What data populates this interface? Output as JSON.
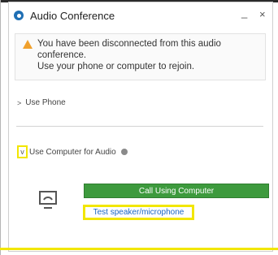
{
  "window": {
    "title": "Audio Conference",
    "minimize_label": "_",
    "close_label": "×",
    "app_icon": "audio-conference-icon"
  },
  "alert": {
    "icon": "warning-icon",
    "line1": "You have been disconnected from this audio conference.",
    "line2": "Use your phone or computer to rejoin."
  },
  "options": {
    "use_phone": {
      "chevron": ">",
      "label": "Use Phone"
    },
    "use_computer": {
      "chevron": "v",
      "label": "Use Computer for Audio",
      "info_icon": "info-icon"
    }
  },
  "call": {
    "button_label": "Call Using Computer",
    "test_link": "Test speaker/microphone",
    "device_icon": "computer-audio-icon"
  },
  "colors": {
    "accent_green": "#3d9a3d",
    "link_blue": "#1a66c4",
    "highlight_yellow": "#f2e600",
    "warning_orange": "#f0a02c"
  }
}
